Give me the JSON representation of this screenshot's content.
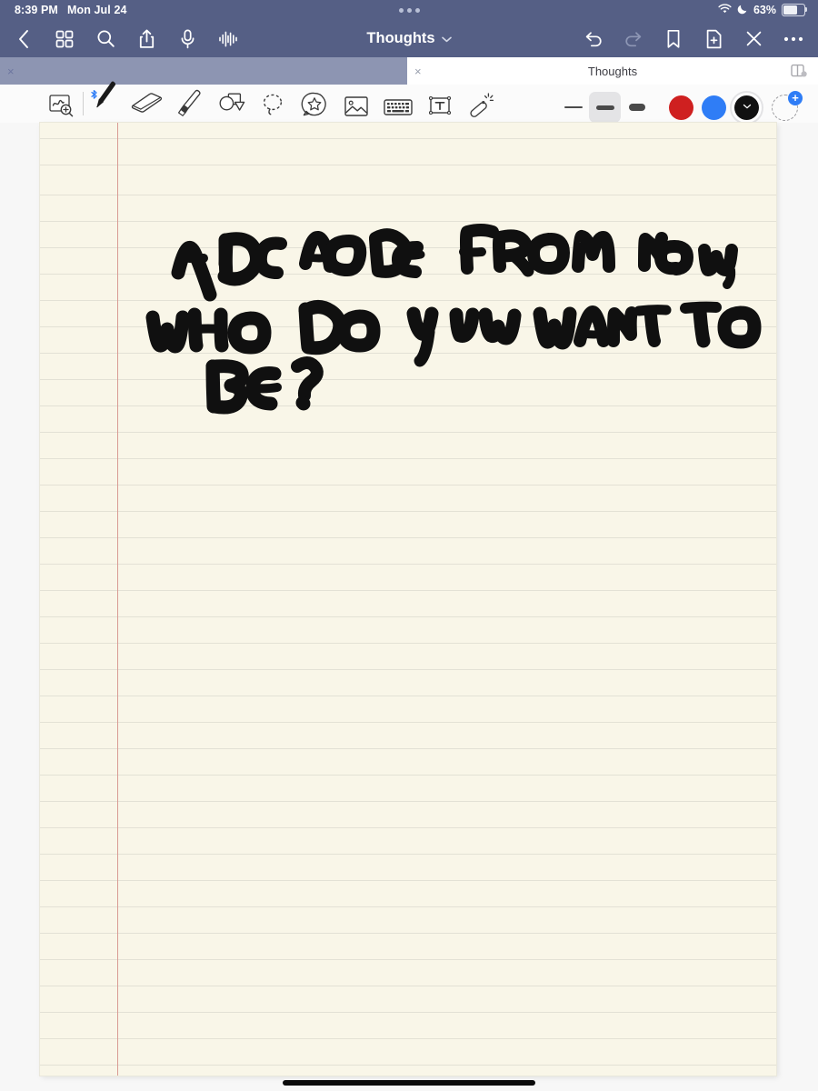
{
  "status_bar": {
    "time": "8:39 PM",
    "date": "Mon Jul 24",
    "battery_percent": "63%",
    "icons": [
      "wifi-icon",
      "do-not-disturb-moon-icon",
      "battery-icon"
    ],
    "multitask_handle": "three-dots-handle"
  },
  "nav_bar": {
    "title": "Thoughts",
    "title_chevron": "⌄",
    "left_icons": [
      {
        "name": "back-chevron-icon",
        "label": "Back"
      },
      {
        "name": "grid-thumbnails-icon",
        "label": "Page Thumbnails"
      },
      {
        "name": "search-icon",
        "label": "Search"
      },
      {
        "name": "share-icon",
        "label": "Share"
      },
      {
        "name": "microphone-icon",
        "label": "Record Audio"
      },
      {
        "name": "waveform-icon",
        "label": "Audio Waveform"
      }
    ],
    "right_icons": [
      {
        "name": "undo-icon",
        "label": "Undo",
        "enabled": true
      },
      {
        "name": "redo-icon",
        "label": "Redo",
        "enabled": false
      },
      {
        "name": "bookmark-icon",
        "label": "Bookmark"
      },
      {
        "name": "new-page-icon",
        "label": "New Page"
      },
      {
        "name": "close-icon",
        "label": "Close"
      },
      {
        "name": "more-ellipsis-icon",
        "label": "More"
      }
    ]
  },
  "tab_bar": {
    "tabs": [
      {
        "label": "",
        "active": false,
        "close": "×"
      },
      {
        "label": "Thoughts",
        "active": true,
        "close": "×"
      }
    ],
    "split_view_icon": "split-view-icon"
  },
  "toolbar": {
    "tools": [
      {
        "name": "zoom-write-tool",
        "label": "Zoom Writing",
        "selected": false
      },
      {
        "name": "pen-tool",
        "label": "Pen",
        "selected": true,
        "bluetooth": true
      },
      {
        "name": "eraser-tool",
        "label": "Eraser",
        "selected": false
      },
      {
        "name": "highlighter-tool",
        "label": "Highlighter",
        "selected": false
      },
      {
        "name": "shapes-tool",
        "label": "Shapes",
        "selected": false
      },
      {
        "name": "lasso-tool",
        "label": "Lasso Select",
        "selected": false
      },
      {
        "name": "sticker-tool",
        "label": "Sticker",
        "selected": false
      },
      {
        "name": "image-tool",
        "label": "Insert Image",
        "selected": false
      },
      {
        "name": "keyboard-tool",
        "label": "Keyboard",
        "selected": false
      },
      {
        "name": "text-box-tool",
        "label": "Text Box",
        "selected": false
      },
      {
        "name": "magic-wand-tool",
        "label": "Magic Wand",
        "selected": false
      }
    ],
    "stroke_widths": [
      {
        "name": "stroke-width-thin",
        "selected": false
      },
      {
        "name": "stroke-width-medium",
        "selected": true
      },
      {
        "name": "stroke-width-thick",
        "selected": false
      }
    ],
    "colors": [
      {
        "name": "color-red",
        "hex": "#CF2020",
        "selected": false
      },
      {
        "name": "color-blue",
        "hex": "#2F7DF6",
        "selected": false
      },
      {
        "name": "color-black",
        "hex": "#111111",
        "selected": true
      }
    ],
    "add_color": {
      "name": "add-color-button",
      "plus": "+",
      "accent": "#2F7DF6"
    }
  },
  "page": {
    "paper_color": "#F9F6E8",
    "rule_color": "#BDBDBD",
    "margin_line_color": "#D99B94",
    "handwriting": "A DECADE FROM NOW, WHO DO YOU WANT TO BE?",
    "handwriting_lines": [
      "A DECADE FROM NOW,",
      "WHO DO YOU WANT TO",
      "BE?"
    ]
  },
  "theme": {
    "chrome": "#555F85",
    "tab_inactive": "#8D95B2",
    "toolbar_bg": "#FBFBFB",
    "canvas_bg": "#F7F7F7"
  }
}
